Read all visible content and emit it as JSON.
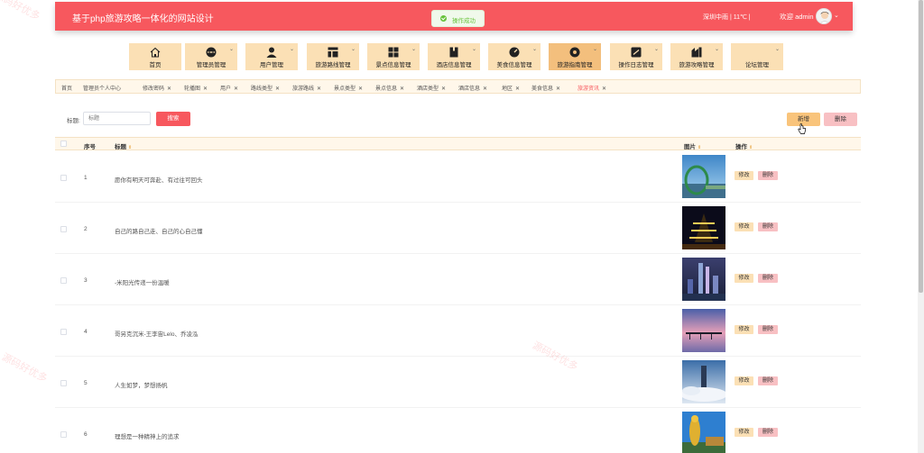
{
  "header": {
    "title": "基于php旅游攻略一体化的网站设计",
    "weather": "深圳中雨 | 11℃ |",
    "welcome": "欢迎 admin",
    "brand_color": "#f7585e"
  },
  "toast": {
    "message": "操作成功",
    "status": "success"
  },
  "menu": [
    {
      "label": "首页",
      "icon": "home-icon",
      "has_arrow": false
    },
    {
      "label": "管理员管理",
      "icon": "admin-icon",
      "has_arrow": true
    },
    {
      "label": "用户管理",
      "icon": "user-icon",
      "has_arrow": true
    },
    {
      "label": "旅游路线管理",
      "icon": "route-icon",
      "has_arrow": true
    },
    {
      "label": "景点信息管理",
      "icon": "grid-icon",
      "has_arrow": true
    },
    {
      "label": "酒店信息管理",
      "icon": "hotel-icon",
      "has_arrow": true
    },
    {
      "label": "美食信息管理",
      "icon": "food-icon",
      "has_arrow": true
    },
    {
      "label": "旅游指南管理",
      "icon": "guide-icon",
      "has_arrow": true,
      "active": true
    },
    {
      "label": "操作日志管理",
      "icon": "log-icon",
      "has_arrow": true
    },
    {
      "label": "旅游攻略管理",
      "icon": "strategy-icon",
      "has_arrow": true
    },
    {
      "label": "论坛管理",
      "icon": "forum-icon",
      "has_arrow": true
    }
  ],
  "tags": [
    {
      "label": "首页",
      "closable": false
    },
    {
      "label": "管理员个人中心",
      "closable": false
    },
    {
      "label": "修改密码",
      "closable": true
    },
    {
      "label": "轮播图",
      "closable": true
    },
    {
      "label": "用户",
      "closable": true
    },
    {
      "label": "路线类型",
      "closable": true
    },
    {
      "label": "旅游路线",
      "closable": true
    },
    {
      "label": "景点类型",
      "closable": true
    },
    {
      "label": "景点信息",
      "closable": true
    },
    {
      "label": "酒店类型",
      "closable": true
    },
    {
      "label": "酒店信息",
      "closable": true
    },
    {
      "label": "地区",
      "closable": true
    },
    {
      "label": "美食信息",
      "closable": true
    },
    {
      "label": "旅游资讯",
      "closable": true,
      "active": true
    }
  ],
  "search": {
    "label": "标题:",
    "placeholder": "标题",
    "button": "搜索"
  },
  "actions": {
    "add": "新增",
    "delete": "删除"
  },
  "table": {
    "columns": {
      "index": "序号",
      "title": "标题",
      "image": "图片",
      "ops": "操作"
    },
    "edit_label": "修改",
    "delete_label": "删除",
    "rows": [
      {
        "index": "1",
        "title": "愿你有明天可奔赴、有过往可回头",
        "image": "arch-bridge-photo"
      },
      {
        "index": "2",
        "title": "自己的路自己走、自己的心自己懂",
        "image": "night-pagoda-photo"
      },
      {
        "index": "3",
        "title": "-米阳光传递一份温暖",
        "image": "city-night-photo"
      },
      {
        "index": "4",
        "title": "哥另克沉米-王李宙Lelo、乔凌泓",
        "image": "pier-sunset-photo"
      },
      {
        "index": "5",
        "title": "人生如梦，梦想扬帆",
        "image": "tower-clouds-photo"
      },
      {
        "index": "6",
        "title": "理想是一种精神上的追求",
        "image": "golden-statue-photo"
      }
    ]
  },
  "watermark": "源码好优多"
}
